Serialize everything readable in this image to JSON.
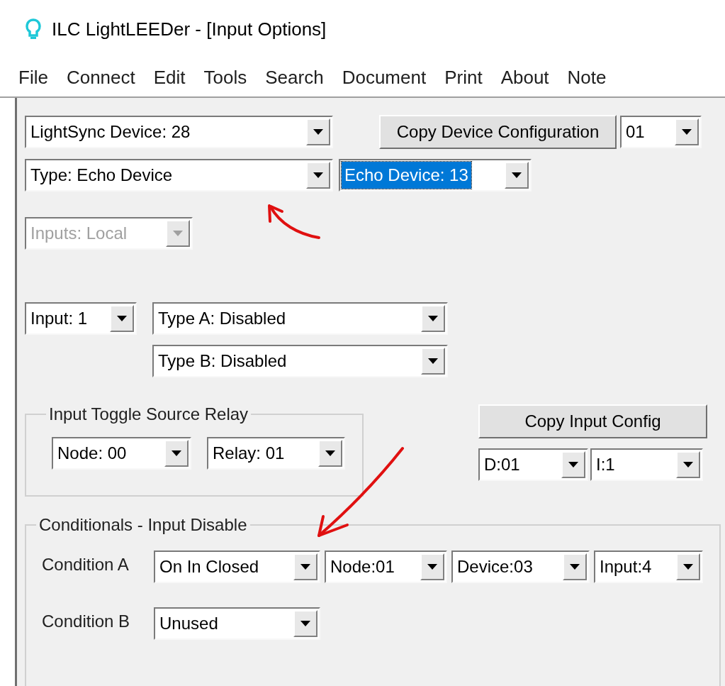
{
  "window": {
    "title": "ILC LightLEEDer - [Input Options]"
  },
  "menu": [
    "File",
    "Connect",
    "Edit",
    "Tools",
    "Search",
    "Document",
    "Print",
    "About",
    "Note"
  ],
  "device": {
    "device_select": {
      "value": "LightSync Device: 28",
      "selected": false,
      "disabled": false
    },
    "copy_button": "Copy Device Configuration",
    "copy_target": {
      "value": "01",
      "selected": false,
      "disabled": false
    },
    "type_select": {
      "value": "Type: Echo Device",
      "selected": false,
      "disabled": false
    },
    "echo_select": {
      "value": "Echo Device: 13",
      "selected": true,
      "disabled": false
    }
  },
  "inputs_select": {
    "value": "Inputs: Local",
    "selected": false,
    "disabled": true
  },
  "input": {
    "input_select": {
      "value": "Input: 1",
      "selected": false,
      "disabled": false
    },
    "type_a": {
      "value": "Type A: Disabled",
      "selected": false,
      "disabled": false
    },
    "type_b": {
      "value": "Type B: Disabled",
      "selected": false,
      "disabled": false
    }
  },
  "toggle_relay": {
    "title": "Input Toggle Source Relay",
    "node": {
      "value": "Node: 00",
      "selected": false,
      "disabled": false
    },
    "relay": {
      "value": "Relay: 01",
      "selected": false,
      "disabled": false
    }
  },
  "copy_input": {
    "button": "Copy Input Config",
    "device": {
      "value": "D:01",
      "selected": false,
      "disabled": false
    },
    "input": {
      "value": "I:1",
      "selected": false,
      "disabled": false
    }
  },
  "conditionals": {
    "title": "Conditionals - Input Disable",
    "rows": [
      {
        "label": "Condition A",
        "selects": [
          {
            "value": "On In Closed",
            "selected": false,
            "disabled": false
          },
          {
            "value": "Node:01",
            "selected": false,
            "disabled": false
          },
          {
            "value": "Device:03",
            "selected": false,
            "disabled": false
          },
          {
            "value": "Input:4",
            "selected": false,
            "disabled": false
          }
        ]
      },
      {
        "label": "Condition B",
        "selects": [
          {
            "value": "Unused",
            "selected": false,
            "disabled": false
          }
        ]
      }
    ]
  }
}
